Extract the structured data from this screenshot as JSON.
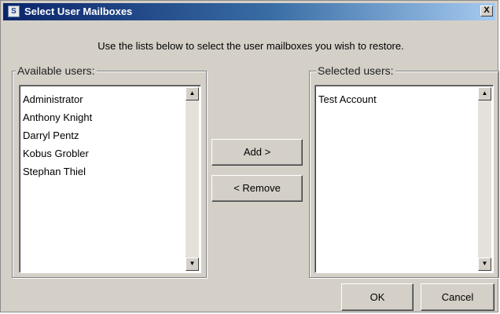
{
  "dialog": {
    "title": "Select User Mailboxes",
    "close_label": "X",
    "instruction": "Use the lists below to select the user mailboxes you wish to restore."
  },
  "available": {
    "label": "Available users:",
    "items": [
      "Administrator",
      "Anthony Knight",
      "Darryl Pentz",
      "Kobus Grobler",
      "Stephan Thiel"
    ]
  },
  "selected": {
    "label": "Selected users:",
    "items": [
      "Test Account"
    ]
  },
  "buttons": {
    "add": "Add >",
    "remove": "< Remove",
    "ok": "OK",
    "cancel": "Cancel"
  },
  "icons": {
    "scroll_up": "▲",
    "scroll_down": "▼",
    "app": "S"
  }
}
